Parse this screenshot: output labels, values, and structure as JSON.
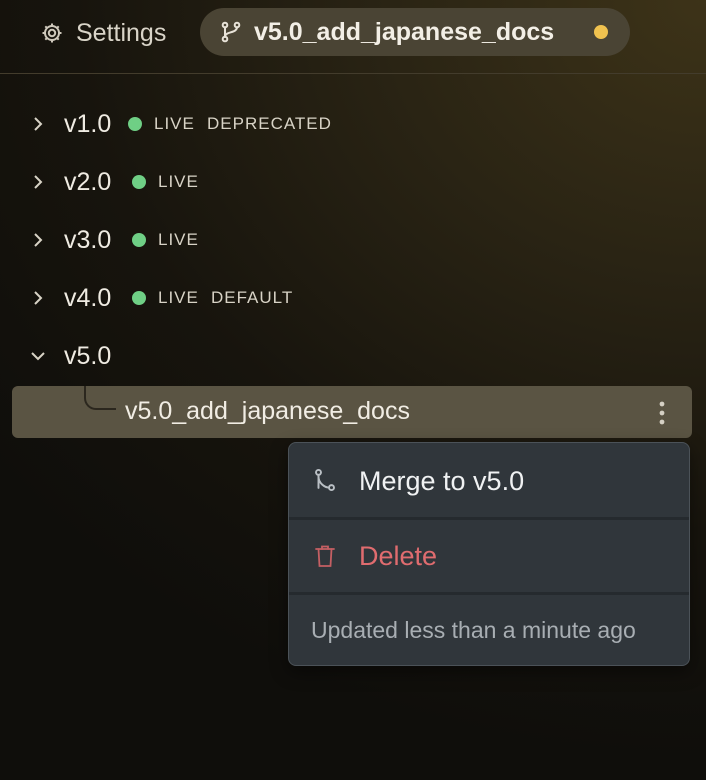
{
  "header": {
    "settings_label": "Settings",
    "settings_icon": "gear-icon",
    "branch_label": "v5.0_add_japanese_docs",
    "branch_icon": "git-branch-icon",
    "unsaved_dot_color": "#f0c24f"
  },
  "versions": [
    {
      "label": "v1.0",
      "expanded": false,
      "live": true,
      "status": "LIVE",
      "badge": "DEPRECATED"
    },
    {
      "label": "v2.0",
      "expanded": false,
      "live": true,
      "status": "LIVE",
      "badge": ""
    },
    {
      "label": "v3.0",
      "expanded": false,
      "live": true,
      "status": "LIVE",
      "badge": ""
    },
    {
      "label": "v4.0",
      "expanded": false,
      "live": true,
      "status": "LIVE",
      "badge": "DEFAULT"
    },
    {
      "label": "v5.0",
      "expanded": true,
      "live": false,
      "status": "",
      "badge": ""
    }
  ],
  "branch": {
    "label": "v5.0_add_japanese_docs",
    "more_icon": "vertical-dots-icon"
  },
  "menu": {
    "merge_label": "Merge to v5.0",
    "merge_icon": "git-merge-icon",
    "delete_label": "Delete",
    "delete_icon": "trash-icon",
    "footer_text": "Updated less than a minute ago"
  },
  "colors": {
    "live_dot": "#6fcf85",
    "delete_text": "#e06c6f",
    "menu_bg": "#30363b"
  }
}
